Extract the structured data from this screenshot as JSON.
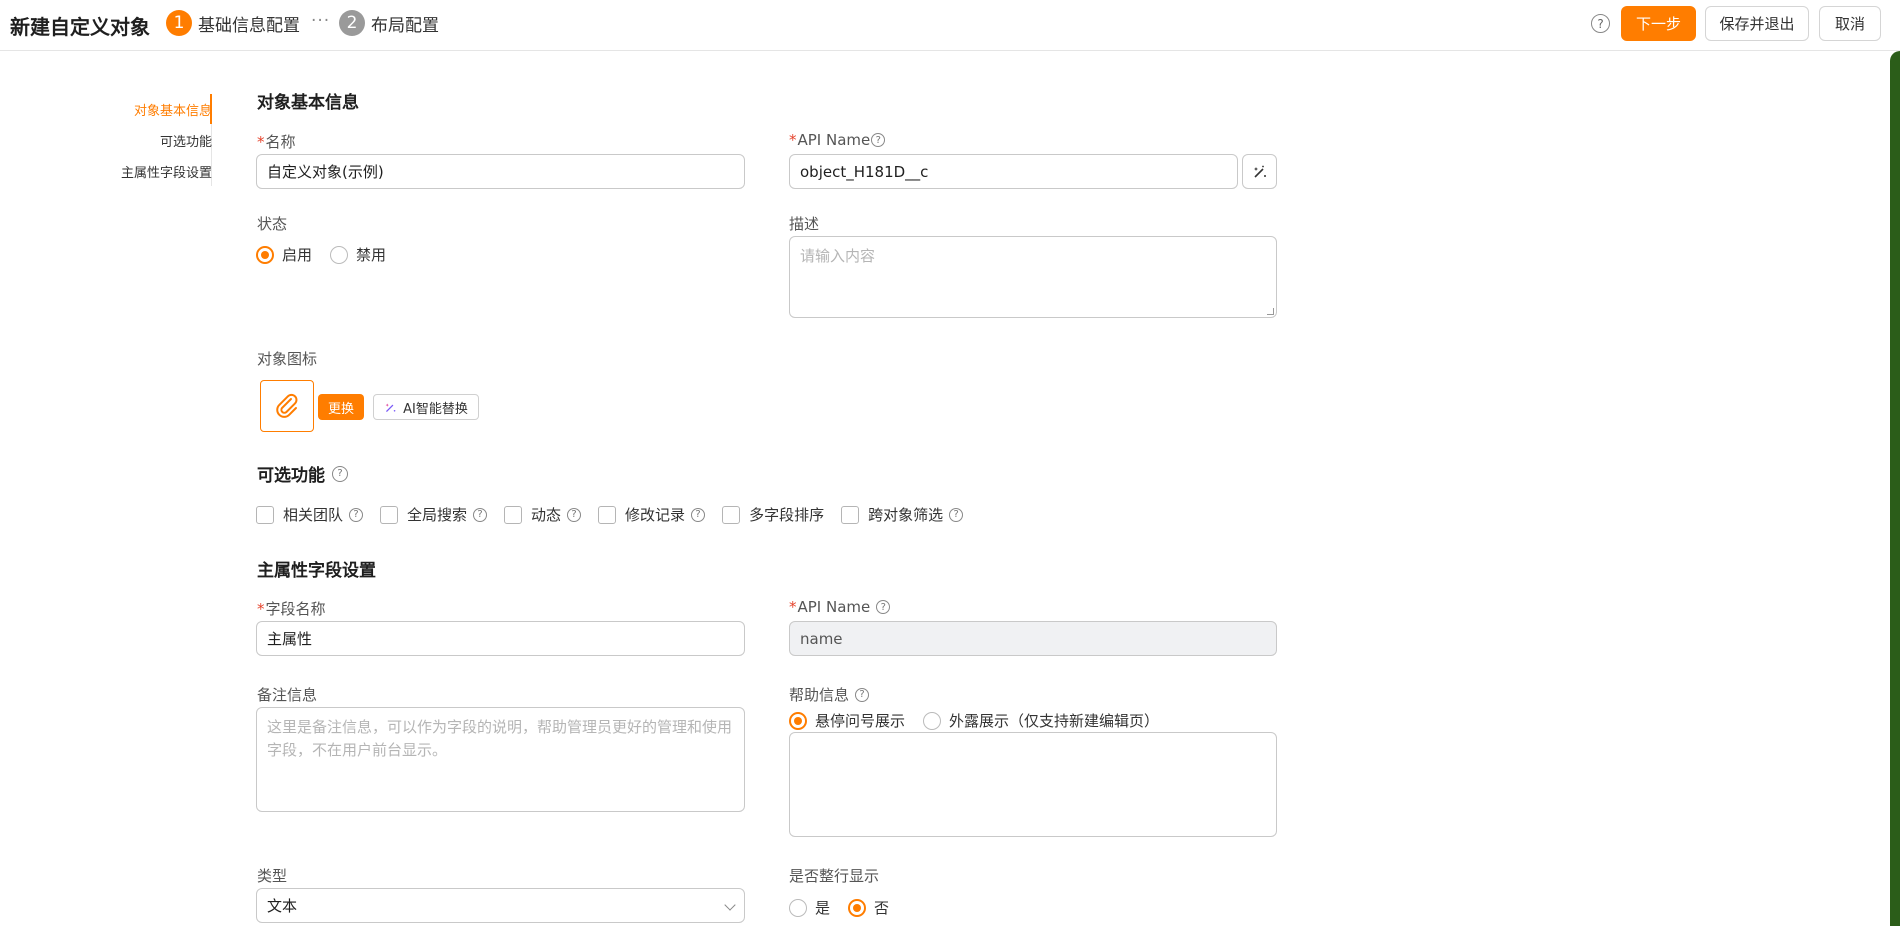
{
  "header": {
    "title": "新建自定义对象",
    "steps": [
      {
        "num": "1",
        "label": "基础信息配置",
        "state": "active"
      },
      {
        "num": "2",
        "label": "布局配置",
        "state": "pending"
      }
    ],
    "step_separator": "···",
    "help_glyph": "?",
    "next_label": "下一步",
    "save_exit_label": "保存并退出",
    "cancel_label": "取消"
  },
  "anchor_nav": {
    "items": [
      "对象基本信息",
      "可选功能",
      "主属性字段设置"
    ],
    "active_index": 0
  },
  "basic_info": {
    "section_title": "对象基本信息",
    "name_label": "名称",
    "name_value": "自定义对象(示例)",
    "api_name_label": "API Name",
    "api_name_value": "object_H181D__c",
    "status_label": "状态",
    "status_options": [
      "启用",
      "禁用"
    ],
    "status_selected": "启用",
    "desc_label": "描述",
    "desc_placeholder": "请输入内容",
    "icon_label": "对象图标",
    "change_label": "更换",
    "ai_replace_label": "AI智能替换"
  },
  "optional_features": {
    "section_title": "可选功能",
    "items": [
      {
        "label": "相关团队",
        "help": true,
        "checked": false
      },
      {
        "label": "全局搜索",
        "help": true,
        "checked": false
      },
      {
        "label": "动态",
        "help": true,
        "checked": false
      },
      {
        "label": "修改记录",
        "help": true,
        "checked": false
      },
      {
        "label": "多字段排序",
        "help": false,
        "checked": false
      },
      {
        "label": "跨对象筛选",
        "help": true,
        "checked": false
      }
    ]
  },
  "main_field": {
    "section_title": "主属性字段设置",
    "field_name_label": "字段名称",
    "field_name_value": "主属性",
    "api_name_label": "API Name",
    "api_name_value": "name",
    "remark_label": "备注信息",
    "remark_placeholder": "这里是备注信息，可以作为字段的说明，帮助管理员更好的管理和使用字段，不在用户前台显示。",
    "help_label": "帮助信息",
    "help_options": [
      "悬停问号展示",
      "外露展示（仅支持新建编辑页）"
    ],
    "help_selected": "悬停问号展示",
    "type_label": "类型",
    "type_value": "文本",
    "full_row_label": "是否整行显示",
    "full_row_options": [
      "是",
      "否"
    ],
    "full_row_selected": "否"
  },
  "colors": {
    "accent": "#ff7d00",
    "required": "#e5442d"
  },
  "icons": [
    "help-icon",
    "magic-wand-icon",
    "paperclip-icon",
    "chevron-down-icon"
  ]
}
